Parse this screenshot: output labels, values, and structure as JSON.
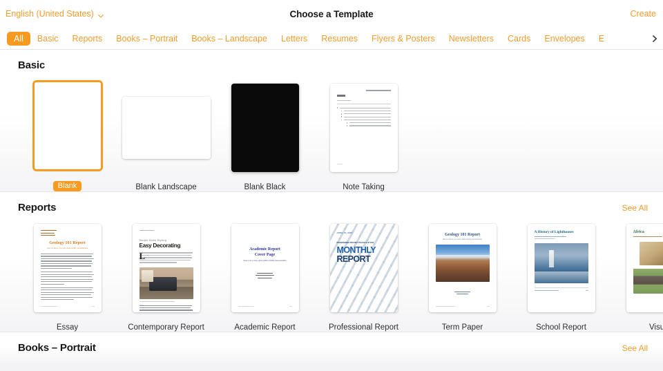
{
  "header": {
    "language": "English (United States)",
    "language_chevron_icon": "chevron-down-icon",
    "title": "Choose a Template",
    "create_label": "Create"
  },
  "tabs": {
    "items": [
      {
        "label": "All",
        "active": true
      },
      {
        "label": "Basic",
        "active": false
      },
      {
        "label": "Reports",
        "active": false
      },
      {
        "label": "Books – Portrait",
        "active": false
      },
      {
        "label": "Books – Landscape",
        "active": false
      },
      {
        "label": "Letters",
        "active": false
      },
      {
        "label": "Resumes",
        "active": false
      },
      {
        "label": "Flyers & Posters",
        "active": false
      },
      {
        "label": "Newsletters",
        "active": false
      },
      {
        "label": "Cards",
        "active": false
      },
      {
        "label": "Envelopes",
        "active": false
      },
      {
        "label": "E",
        "active": false
      }
    ],
    "scroll_right_icon": "chevron-right-icon"
  },
  "sections": [
    {
      "title": "Basic",
      "see_all": "",
      "templates": [
        {
          "label": "Blank",
          "kind": "blank",
          "orientation": "portrait",
          "selected": true
        },
        {
          "label": "Blank Landscape",
          "kind": "blank",
          "orientation": "landscape",
          "selected": false
        },
        {
          "label": "Blank Black",
          "kind": "black",
          "orientation": "portrait",
          "selected": false
        },
        {
          "label": "Note Taking",
          "kind": "note",
          "orientation": "portrait",
          "selected": false
        }
      ]
    },
    {
      "title": "Reports",
      "see_all": "See All",
      "templates": [
        {
          "label": "Essay",
          "kind": "essay",
          "orientation": "portrait",
          "selected": false,
          "art": {
            "title": "Geology 101 Report",
            "subtitle": "And we know you were made totally awesomeness"
          }
        },
        {
          "label": "Contemporary Report",
          "kind": "contemporary",
          "orientation": "portrait",
          "selected": false,
          "art": {
            "eyebrow": "Simple Home Styling",
            "title": "Easy Decorating",
            "dropcap": "L"
          }
        },
        {
          "label": "Academic Report",
          "kind": "academic",
          "orientation": "portrait",
          "selected": false,
          "art": {
            "title_line1": "Academic Report",
            "title_line2": "Cover Page",
            "subtitle": "Steel roll occupy sprite ambit reliable maecquemiss"
          }
        },
        {
          "label": "Professional Report",
          "kind": "professional",
          "orientation": "portrait",
          "selected": false,
          "art": {
            "date": "APRIL 15, 2020",
            "kicker": "MODERNIZING PROJECT PHASE CLIP FAR",
            "title_line1": "MONTHLY",
            "title_line2": "REPORT"
          }
        },
        {
          "label": "Term Paper",
          "kind": "termpaper",
          "orientation": "portrait",
          "selected": false,
          "art": {
            "title": "Geology 101 Report",
            "subtitle": "Ded we know you were made totally awesomeness",
            "author": "Vivian Thompson",
            "term": "Fall 2020"
          }
        },
        {
          "label": "School Report",
          "kind": "school",
          "orientation": "portrait",
          "selected": false,
          "art": {
            "title": "A History of Lighthouses"
          }
        },
        {
          "label": "Visual",
          "kind": "visual",
          "orientation": "portrait",
          "selected": false,
          "art": {
            "title": "Africa"
          }
        }
      ]
    },
    {
      "title": "Books – Portrait",
      "see_all": "See All",
      "templates": []
    }
  ],
  "colors": {
    "accent": "#f89a21",
    "accent_text": "#f79b2c",
    "text": "#16181a",
    "canvas": "#f3f3f5"
  }
}
